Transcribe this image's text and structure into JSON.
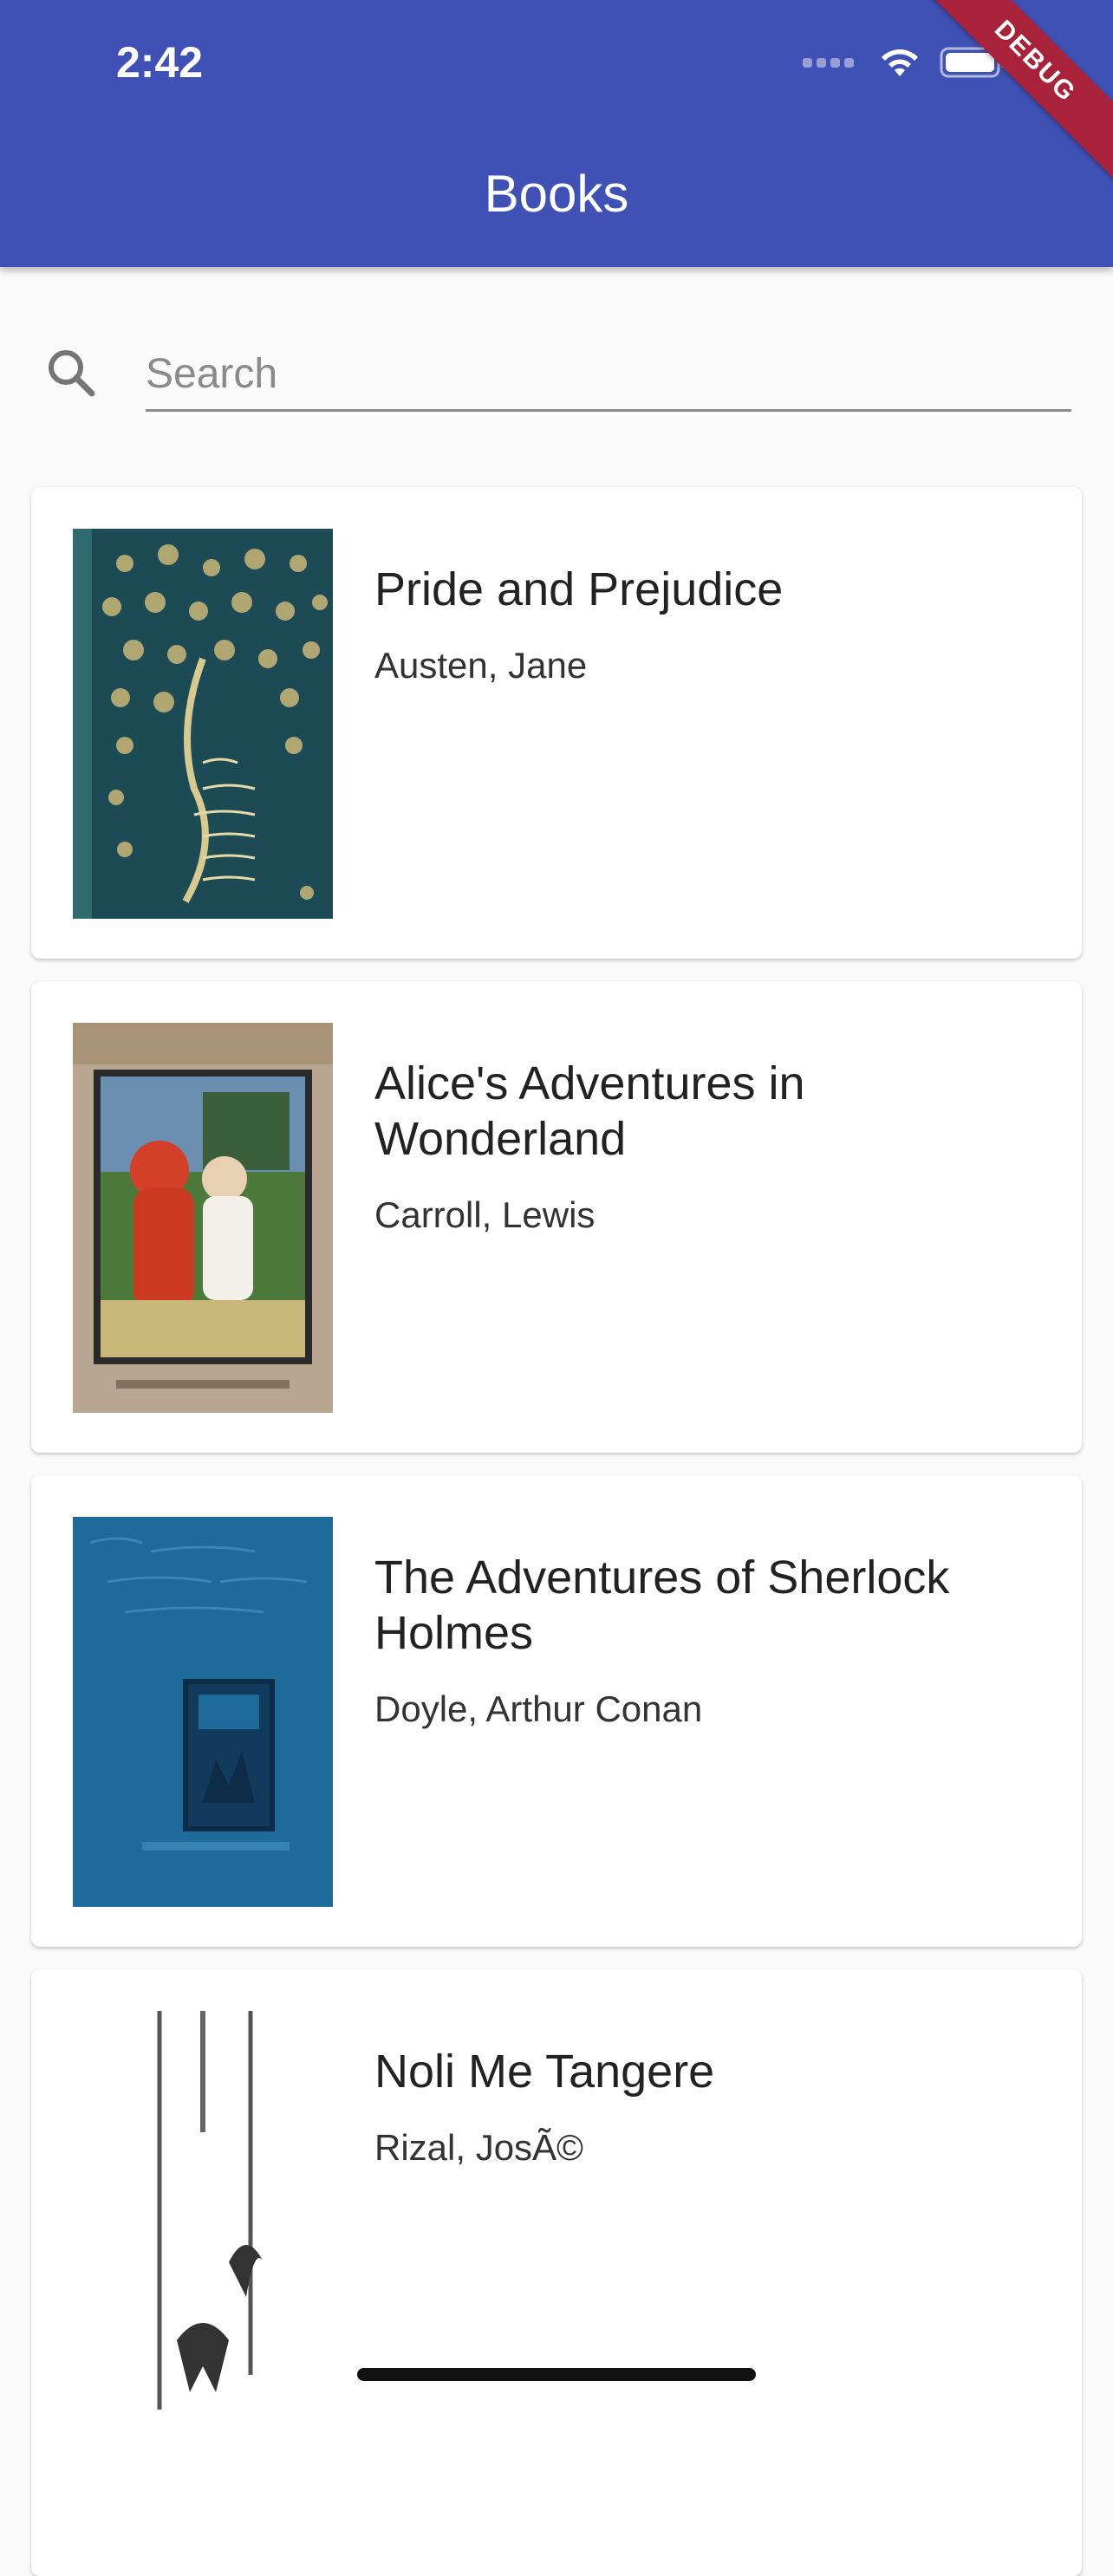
{
  "status_bar": {
    "time": "2:42"
  },
  "app_bar": {
    "title": "Books",
    "debug_label": "DEBUG"
  },
  "search": {
    "placeholder": "Search",
    "value": ""
  },
  "books": [
    {
      "title": "Pride and Prejudice",
      "author": "Austen, Jane",
      "cover_colors": [
        "#1c4b55",
        "#c9b777"
      ]
    },
    {
      "title": "Alice's Adventures in Wonderland",
      "author": "Carroll, Lewis",
      "cover_colors": [
        "#b8a690",
        "#cc3a24"
      ]
    },
    {
      "title": "The Adventures of Sherlock Holmes",
      "author": "Doyle, Arthur Conan",
      "cover_colors": [
        "#1e6a9a",
        "#123a5c"
      ]
    },
    {
      "title": "Noli Me Tangere",
      "author": "Rizal, JosÃ©",
      "cover_colors": [
        "#ffffff",
        "#333333"
      ]
    }
  ],
  "colors": {
    "primary": "#3f51b5",
    "debug_ribbon": "#a8233a",
    "background": "#fafafa"
  }
}
